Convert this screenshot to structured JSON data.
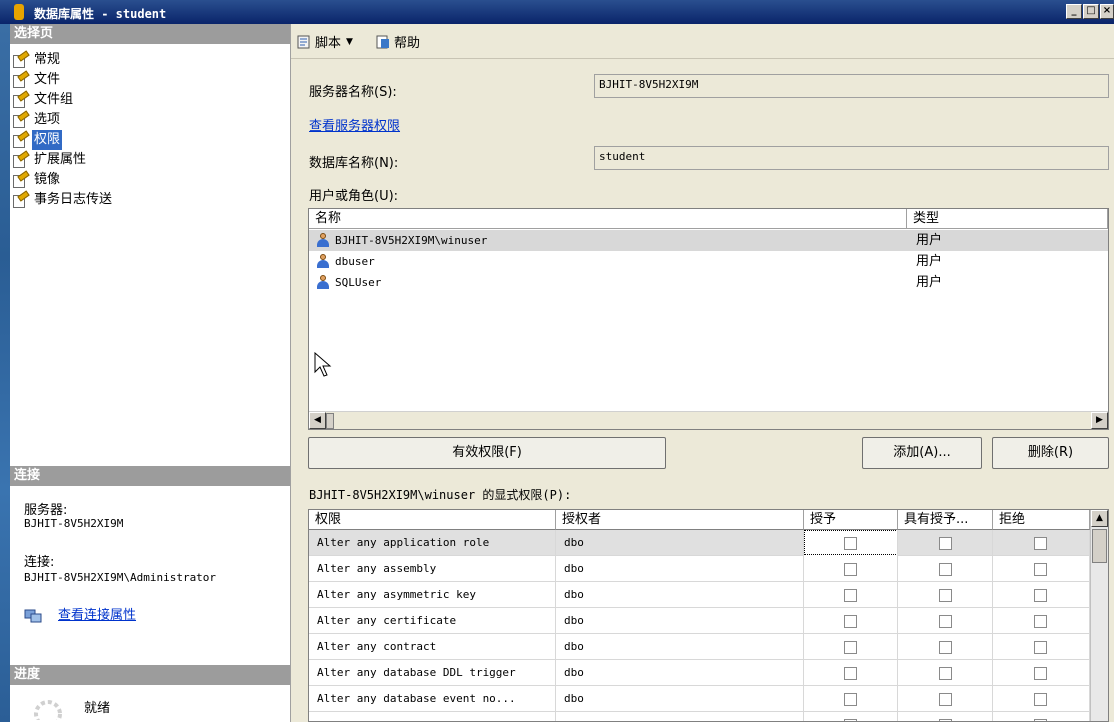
{
  "window": {
    "title": "数据库属性 - student"
  },
  "left": {
    "select_page_header": "选择页",
    "pages": [
      {
        "label": "常规"
      },
      {
        "label": "文件"
      },
      {
        "label": "文件组"
      },
      {
        "label": "选项"
      },
      {
        "label": "权限"
      },
      {
        "label": "扩展属性"
      },
      {
        "label": "镜像"
      },
      {
        "label": "事务日志传送"
      }
    ],
    "selected_page": "权限",
    "connection_header": "连接",
    "server_label": "服务器:",
    "server_value": "BJHIT-8V5H2XI9M",
    "connection_label": "连接:",
    "connection_value": "BJHIT-8V5H2XI9M\\Administrator",
    "view_connection_props": "查看连接属性",
    "progress_header": "进度",
    "progress_status": "就绪"
  },
  "toolbar": {
    "script": "脚本",
    "help": "帮助"
  },
  "form": {
    "server_name_label": "服务器名称(S):",
    "server_name_value": "BJHIT-8V5H2XI9M",
    "view_server_perms": "查看服务器权限",
    "db_name_label": "数据库名称(N):",
    "db_name_value": "student",
    "users_roles_label": "用户或角色(U):"
  },
  "users_list": {
    "columns": [
      "名称",
      "类型"
    ],
    "rows": [
      {
        "name": "BJHIT-8V5H2XI9M\\winuser",
        "type": "用户"
      },
      {
        "name": "dbuser",
        "type": "用户"
      },
      {
        "name": "SQLUser",
        "type": "用户"
      }
    ]
  },
  "buttons": {
    "effective": "有效权限(F)",
    "add": "添加(A)...",
    "remove": "删除(R)"
  },
  "perms_label": "BJHIT-8V5H2XI9M\\winuser 的显式权限(P):",
  "perms_grid": {
    "columns": [
      "权限",
      "授权者",
      "授予",
      "具有授予...",
      "拒绝"
    ],
    "rows": [
      {
        "perm": "Alter any application role",
        "grantor": "dbo"
      },
      {
        "perm": "Alter any assembly",
        "grantor": "dbo"
      },
      {
        "perm": "Alter any asymmetric key",
        "grantor": "dbo"
      },
      {
        "perm": "Alter any certificate",
        "grantor": "dbo"
      },
      {
        "perm": "Alter any contract",
        "grantor": "dbo"
      },
      {
        "perm": "Alter any database DDL trigger",
        "grantor": "dbo"
      },
      {
        "perm": "Alter any database event no...",
        "grantor": "dbo"
      },
      {
        "perm": "",
        "grantor": ""
      }
    ]
  }
}
